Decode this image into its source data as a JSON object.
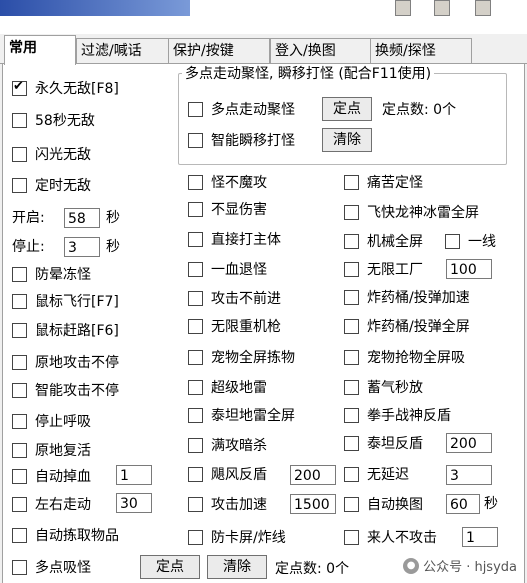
{
  "tabs": [
    "常用",
    "过滤/喊话",
    "保护/按键",
    "登入/换图",
    "换频/探怪"
  ],
  "group": {
    "title": "多点走动聚怪, 瞬移打怪 (配合F11使用)",
    "multi_point_label": "多点走动聚怪",
    "set_point_button": "定点",
    "point_count_label": "定点数: 0个",
    "smart_blink_label": "智能瞬移打怪",
    "clear_button": "清除"
  },
  "col1": {
    "permanent_invincible": "永久无敌[F8]",
    "invincible_58s": "58秒无敌",
    "flash_invincible": "闪光无敌",
    "timed_invincible": "定时无敌",
    "start_label": "开启:",
    "start_value": "58",
    "start_unit": "秒",
    "stop_label": "停止:",
    "stop_value": "3",
    "stop_unit": "秒",
    "anti_stun_freeze": "防晕冻怪",
    "mouse_fly": "鼠标飞行[F7]",
    "mouse_run": "鼠标赶路[F6]",
    "stationary_attack": "原地攻击不停",
    "smart_attack": "智能攻击不停",
    "stop_breathing": "停止呼吸",
    "revive_in_place": "原地复活",
    "auto_drop_hp": "自动掉血",
    "auto_drop_hp_value": "1",
    "left_right_walk": "左右走动",
    "left_right_walk_value": "30",
    "auto_pickup": "自动拣取物品",
    "multi_point_absorb": "多点吸怪",
    "set_point_button": "定点",
    "clear_button": "清除",
    "point_count": "定点数: 0个"
  },
  "col2": {
    "monster_no_attack": "怪不魔攻",
    "hide_damage": "不显伤害",
    "attack_main": "直接打主体",
    "one_hp_retreat": "一血退怪",
    "attack_no_advance": "攻击不前进",
    "infinite_heavy_gun": "无限重机枪",
    "pet_full_screen": "宠物全屏拣物",
    "super_mine": "超级地雷",
    "titan_mine": "泰坦地雷全屏",
    "full_attack_stealth": "满攻暗杀",
    "hurricane_shield": "飓风反盾",
    "hurricane_shield_value": "200",
    "attack_speed": "攻击加速",
    "attack_speed_value": "1500",
    "anti_lag": "防卡屏/炸线"
  },
  "col3": {
    "pain_freeze": "痛苦定怪",
    "flying_dragon": "飞快龙神冰雷全屏",
    "mech_full_screen": "机械全屏",
    "one_line": "一线",
    "infinite_factory": "无限工厂",
    "infinite_factory_value": "100",
    "barrel_speed": "炸药桶/投弹加速",
    "barrel_full": "炸药桶/投弹全屏",
    "pet_grab": "宠物抢物全屏吸",
    "charge_instant": "蓄气秒放",
    "fist_war_god": "拳手战神反盾",
    "titan_shield": "泰坦反盾",
    "titan_shield_value": "200",
    "no_delay": "无延迟",
    "no_delay_value": "3",
    "auto_map_change": "自动换图",
    "auto_map_change_value": "60",
    "auto_map_change_unit": "秒",
    "no_attack_on_people": "来人不攻击",
    "no_attack_on_people_value": "1"
  },
  "watermark": "公众号 · hjsyda"
}
